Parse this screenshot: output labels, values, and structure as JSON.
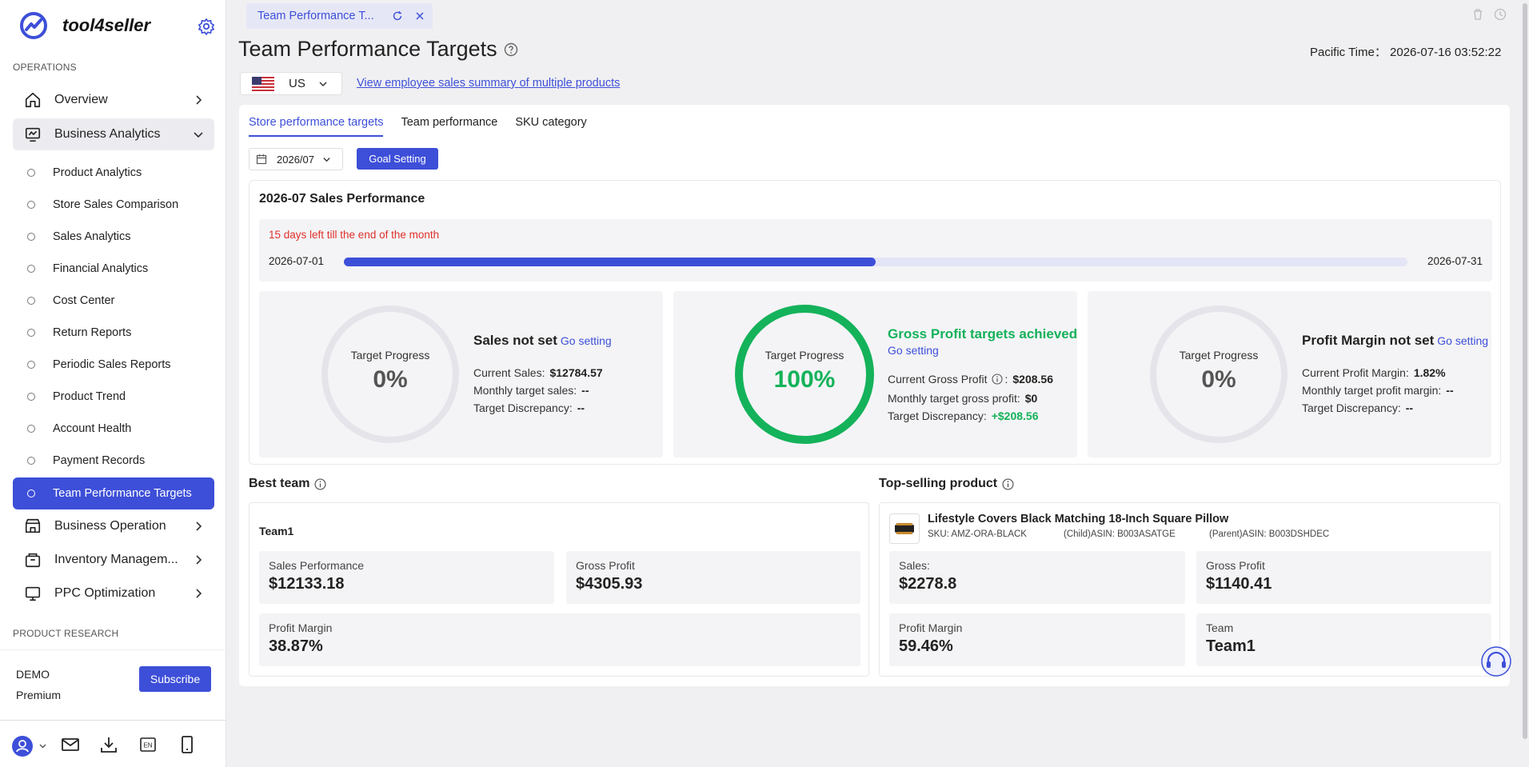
{
  "app": {
    "brand": "tool4seller"
  },
  "sidebar": {
    "section_operations": "OPERATIONS",
    "section_research": "PRODUCT RESEARCH",
    "nav": [
      {
        "label": "Overview"
      },
      {
        "label": "Business Analytics"
      },
      {
        "label": "Business Operation"
      },
      {
        "label": "Inventory Managem..."
      },
      {
        "label": "PPC Optimization"
      }
    ],
    "sub_items": [
      {
        "label": "Product Analytics"
      },
      {
        "label": "Store Sales Comparison"
      },
      {
        "label": "Sales Analytics"
      },
      {
        "label": "Financial Analytics"
      },
      {
        "label": "Cost Center"
      },
      {
        "label": "Return Reports"
      },
      {
        "label": "Periodic Sales Reports"
      },
      {
        "label": "Product Trend"
      },
      {
        "label": "Account Health"
      },
      {
        "label": "Payment Records"
      },
      {
        "label": "Team Performance Targets"
      }
    ],
    "account": {
      "name": "DEMO",
      "plan": "Premium",
      "subscribe_label": "Subscribe"
    },
    "bottom_icons": [
      "user-icon",
      "mail-icon",
      "download-icon",
      "language-icon",
      "mobile-icon"
    ],
    "lang_badge": "EN"
  },
  "tabbar": {
    "tab_label": "Team Performance T..."
  },
  "header": {
    "title": "Team Performance Targets",
    "pacific_time_label": "Pacific Time：",
    "pacific_time_value": "2026-07-16 03:52:22",
    "country": "US",
    "multi_link": "View employee sales summary of multiple products"
  },
  "sub_tabs": [
    "Store performance targets",
    "Team performance",
    "SKU category"
  ],
  "filters": {
    "month": "2026/07",
    "goal_button": "Goal Setting"
  },
  "performance": {
    "title": "2026-07 Sales Performance",
    "days_left": "15 days left till the end of the month",
    "date_start": "2026-07-01",
    "date_end": "2026-07-31",
    "month_progress": 0.5
  },
  "targets": [
    {
      "ring_label": "Target Progress",
      "ring_value": "0%",
      "progress": 0,
      "heading": "Sales not set",
      "link": "Go setting",
      "lines": [
        {
          "label": "Current Sales:",
          "value": "$12784.57"
        },
        {
          "label": "Monthly target sales:",
          "value": "--"
        },
        {
          "label": "Target Discrepancy:",
          "value": "--"
        }
      ]
    },
    {
      "ring_label": "Target Progress",
      "ring_value": "100%",
      "progress": 1,
      "heading": "Gross Profit targets achieved",
      "link": "Go setting",
      "lines": [
        {
          "label": "Current Gross Profit",
          "value": "$208.56"
        },
        {
          "label": "Monthly target gross profit:",
          "value": "$0"
        },
        {
          "label": "Target Discrepancy:",
          "value": "+$208.56"
        }
      ]
    },
    {
      "ring_label": "Target Progress",
      "ring_value": "0%",
      "progress": 0,
      "heading": "Profit Margin not set",
      "link": "Go setting",
      "lines": [
        {
          "label": "Current Profit Margin:",
          "value": "1.82%"
        },
        {
          "label": "Monthly target profit margin:",
          "value": "--"
        },
        {
          "label": "Target Discrepancy:",
          "value": "--"
        }
      ]
    }
  ],
  "best_team": {
    "title": "Best team",
    "team_name": "Team1",
    "stats": [
      {
        "label": "Sales Performance",
        "value": "$12133.18"
      },
      {
        "label": "Gross Profit",
        "value": "$4305.93"
      },
      {
        "label": "Profit Margin",
        "value": "38.87%"
      }
    ]
  },
  "top_product": {
    "title": "Top-selling product",
    "name": "Lifestyle Covers Black Matching 18-Inch Square Pillow",
    "sku": "SKU: AMZ-ORA-BLACK",
    "child_asin": "(Child)ASIN: B003ASATGE",
    "parent_asin": "(Parent)ASIN: B003DSHDEC",
    "stats": [
      {
        "label": "Sales:",
        "value": "$2278.8"
      },
      {
        "label": "Gross Profit",
        "value": "$1140.41"
      },
      {
        "label": "Profit Margin",
        "value": "59.46%"
      },
      {
        "label": "Team",
        "value": "Team1"
      }
    ]
  },
  "colors": {
    "accent": "#3d4fd8",
    "success": "#14b25a",
    "warning": "#e0302b"
  }
}
